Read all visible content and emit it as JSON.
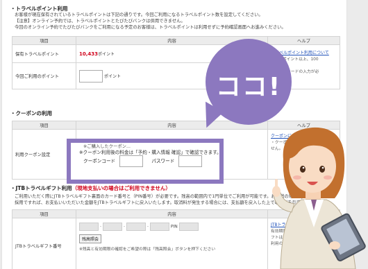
{
  "travel_points": {
    "title": "・トラベルポイント利用",
    "notes": [
      "お客様が現在保有されているトラベルポイントは下記の通りです。今回ご利用になるトラベルポイント数を設定してください。",
      "【注意】オンライン予約では、トラベルポイントとたびたびバンクは併用できません。",
      "今回のオンライン予約でたびたびバンクをご利用になる予定のお客様は、トラベルポイントは利用せずに予約確認画面へお進みください。"
    ],
    "headers": {
      "item": "項目",
      "content": "内容",
      "help": "ヘルプ"
    },
    "held_label": "保有トラベルポイント",
    "held_value": "10,433",
    "held_unit": "ポイント",
    "use_label": "今回ご利用のポイント",
    "use_unit": "ポイント",
    "help_link": "トラベルポイント利用について",
    "help_lines": [
      "は100ポイント以上、100",
      "ます。",
      "トラベルカードの入力が必"
    ]
  },
  "coupon": {
    "title": "・クーポンの利用",
    "headers": {
      "item": "項目",
      "content": "内容",
      "help": "ヘルプ"
    },
    "row_label": "利用クーポン設定",
    "line1": "※ご購入したクーポン...",
    "line2": "※クーポン利用後の料金は「予約・購入情報 確認」で確認できます。",
    "code_label": "クーポンコード",
    "password_label": "パスワード",
    "help_link": "クーポンについて",
    "help_lines": [
      "・クーポンを取消",
      "せん。"
    ]
  },
  "jtb_gift": {
    "title": "・JTBトラベルギフト利用",
    "title_note": "（現地支払いの場合はご利用できません）",
    "notes": [
      "ご利用いただく際にJTBトラベルギフト裏面のカード番号と（PIN番号）が必要です。残高の範囲内で1円単位でご利用が可能です。お取消の場合、JTBトラベ",
      "採用ですれば、お支払いいただいた金額をJTBトラベルギフトに戻入いたします。取消料が発生する場合には、支払額を戻入した上で取消料を引落しいたします。"
    ],
    "headers": {
      "item": "項目",
      "content": "内容",
      "help": "ヘルプ"
    },
    "row_label": "JTBトラベルギフト番号",
    "pin_label": "PIN",
    "balance_button": "残高照会",
    "footnote": "※残高と有効期限の確認をご希望の際は「残高照会」ボタンを押下ください",
    "help_link": "JTBトラベ",
    "help_lines": [
      "有効期限がすべ",
      "フトは一括で",
      "利用の際はご"
    ]
  },
  "callout": {
    "text": "ココ!"
  },
  "colors": {
    "accent": "#8c78bf",
    "points": "#d0021b",
    "link": "#1d4fb8"
  }
}
